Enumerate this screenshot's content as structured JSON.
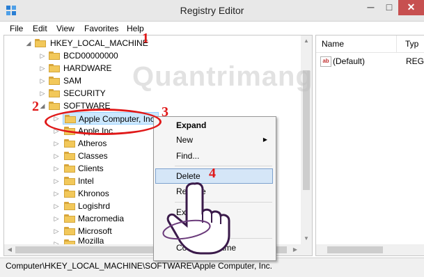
{
  "window": {
    "title": "Registry Editor",
    "buttons": {
      "minimize": "─",
      "maximize": "□",
      "close": "✕"
    }
  },
  "menubar": [
    "File",
    "Edit",
    "View",
    "Favorites",
    "Help"
  ],
  "tree": {
    "root": "HKEY_LOCAL_MACHINE",
    "items": [
      {
        "label": "BCD00000000"
      },
      {
        "label": "HARDWARE"
      },
      {
        "label": "SAM"
      },
      {
        "label": "SECURITY"
      },
      {
        "label": "SOFTWARE"
      },
      {
        "label": "Apple Computer, Inc"
      },
      {
        "label": "Apple Inc."
      },
      {
        "label": "Atheros"
      },
      {
        "label": "Classes"
      },
      {
        "label": "Clients"
      },
      {
        "label": "Intel"
      },
      {
        "label": "Khronos"
      },
      {
        "label": "Logishrd"
      },
      {
        "label": "Macromedia"
      },
      {
        "label": "Microsoft"
      },
      {
        "label": "Mozilla"
      }
    ]
  },
  "list": {
    "columns": {
      "name": "Name",
      "type": "Typ"
    },
    "rows": [
      {
        "icon": "ab",
        "name": "(Default)",
        "type": "REG"
      }
    ]
  },
  "context_menu": {
    "items": [
      "Expand",
      "New",
      "Find...",
      "Delete",
      "Rename",
      "Export",
      "Permissions...",
      "Copy Key Name"
    ],
    "visible_fragments": {
      "rename": "Re",
      "rename_tail": "e",
      "export": "Ex",
      "permissions": "...",
      "copy": "Co",
      "copy_tail": "Name"
    }
  },
  "statusbar": {
    "path": "Computer\\HKEY_LOCAL_MACHINE\\SOFTWARE\\Apple Computer, Inc."
  },
  "annotations": [
    "1",
    "2",
    "3",
    "4"
  ],
  "watermark": "Quantrimang",
  "colors": {
    "annotation": "#e01818",
    "close_button": "#c75050",
    "folder": "#f2c85a",
    "highlight": "#d5e6f7"
  }
}
